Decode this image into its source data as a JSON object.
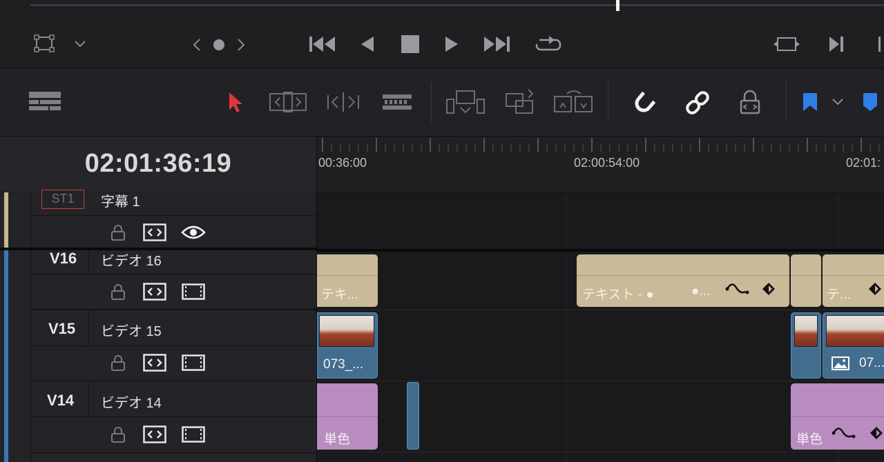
{
  "transport": {
    "icons": [
      "crop-icon",
      "chevron-down-icon",
      "prev-marker-icon",
      "dot-icon",
      "next-marker-icon",
      "skip-to-start-icon",
      "reverse-play-icon",
      "stop-icon",
      "play-icon",
      "skip-to-end-icon",
      "loop-icon",
      "match-frame-icon",
      "next-edit-icon"
    ]
  },
  "toolbar": {
    "icons": [
      "timeline-view-icon",
      "selection-arrow-icon",
      "trim-edit-icon",
      "dynamic-trim-icon",
      "blade-icon",
      "insert-clip-icon",
      "overwrite-clip-icon",
      "replace-clip-icon",
      "snapping-icon",
      "linked-selection-icon",
      "position-lock-icon",
      "flag-icon",
      "chevron-down-icon",
      "marker-icon"
    ],
    "accent_selection": "#e0373a",
    "accent_flag": "#2f7fe6"
  },
  "timecode": "02:01:36:19",
  "ruler": {
    "labels": [
      "00:36:00",
      "02:00:54:00",
      "02:01:"
    ]
  },
  "tracks": [
    {
      "id": "ST1",
      "name": "ST1",
      "label": "字幕 1",
      "color": "#c7b694",
      "toggles": [
        "lock-icon",
        "auto-select-icon",
        "visibility-eye-icon"
      ]
    },
    {
      "id": "V16",
      "name": "V16",
      "label": "ビデオ 16",
      "color": "#3a78b6",
      "toggles": [
        "lock-icon",
        "auto-select-icon",
        "track-enable-icon"
      ]
    },
    {
      "id": "V15",
      "name": "V15",
      "label": "ビデオ 15",
      "color": "#3a78b6",
      "toggles": [
        "lock-icon",
        "auto-select-icon",
        "track-enable-icon"
      ]
    },
    {
      "id": "V14",
      "name": "V14",
      "label": "ビデオ 14",
      "color": "#3a78b6",
      "toggles": [
        "lock-icon",
        "auto-select-icon",
        "track-enable-icon"
      ]
    }
  ],
  "clips": {
    "v16_a": "テキ...",
    "v16_b": "テキスト - ●",
    "v16_b_extra": "●...",
    "v16_c": "テ...",
    "v15_a": "073_...",
    "v15_c": "07...",
    "v14_a": "単色",
    "v14_c": "単色"
  },
  "colors": {
    "text_clip": "#c9bb9a",
    "video_clip": "#436d8f",
    "solid_clip": "#b98cc0"
  }
}
